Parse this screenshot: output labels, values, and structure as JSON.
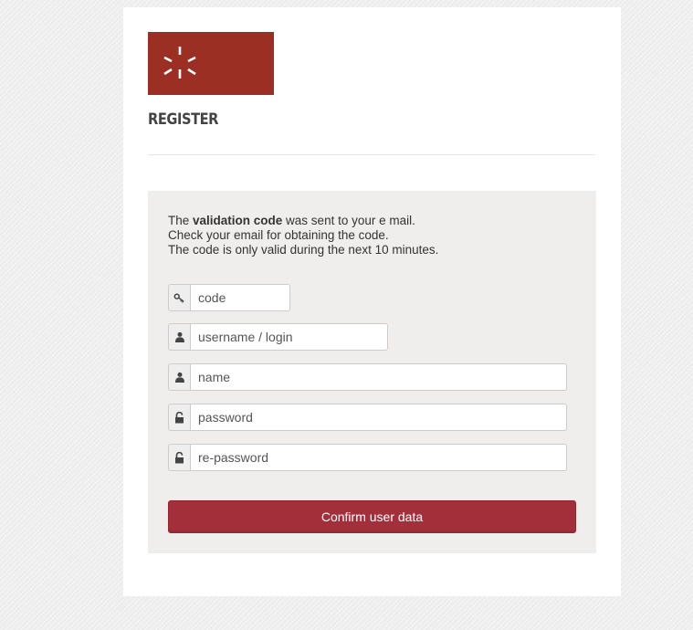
{
  "page": {
    "title": "REGISTER",
    "logo_icon": "asterisk-burst-icon",
    "colors": {
      "brand": "#9b2f24",
      "button": "#a32f3a",
      "panel": "#efeeec"
    }
  },
  "message": {
    "line1_prefix": "The ",
    "line1_bold": "validation code",
    "line1_suffix": " was sent to your e mail.",
    "line2": "Check your email for obtaining the code.",
    "line3": "The code is only valid during the next 10 minutes."
  },
  "form": {
    "fields": [
      {
        "icon": "key-icon",
        "placeholder": "code"
      },
      {
        "icon": "user-icon",
        "placeholder": "username / login"
      },
      {
        "icon": "user-icon",
        "placeholder": "name"
      },
      {
        "icon": "lock-icon",
        "placeholder": "password"
      },
      {
        "icon": "lock-icon",
        "placeholder": "re-password"
      }
    ],
    "submit_label": "Confirm user data"
  }
}
